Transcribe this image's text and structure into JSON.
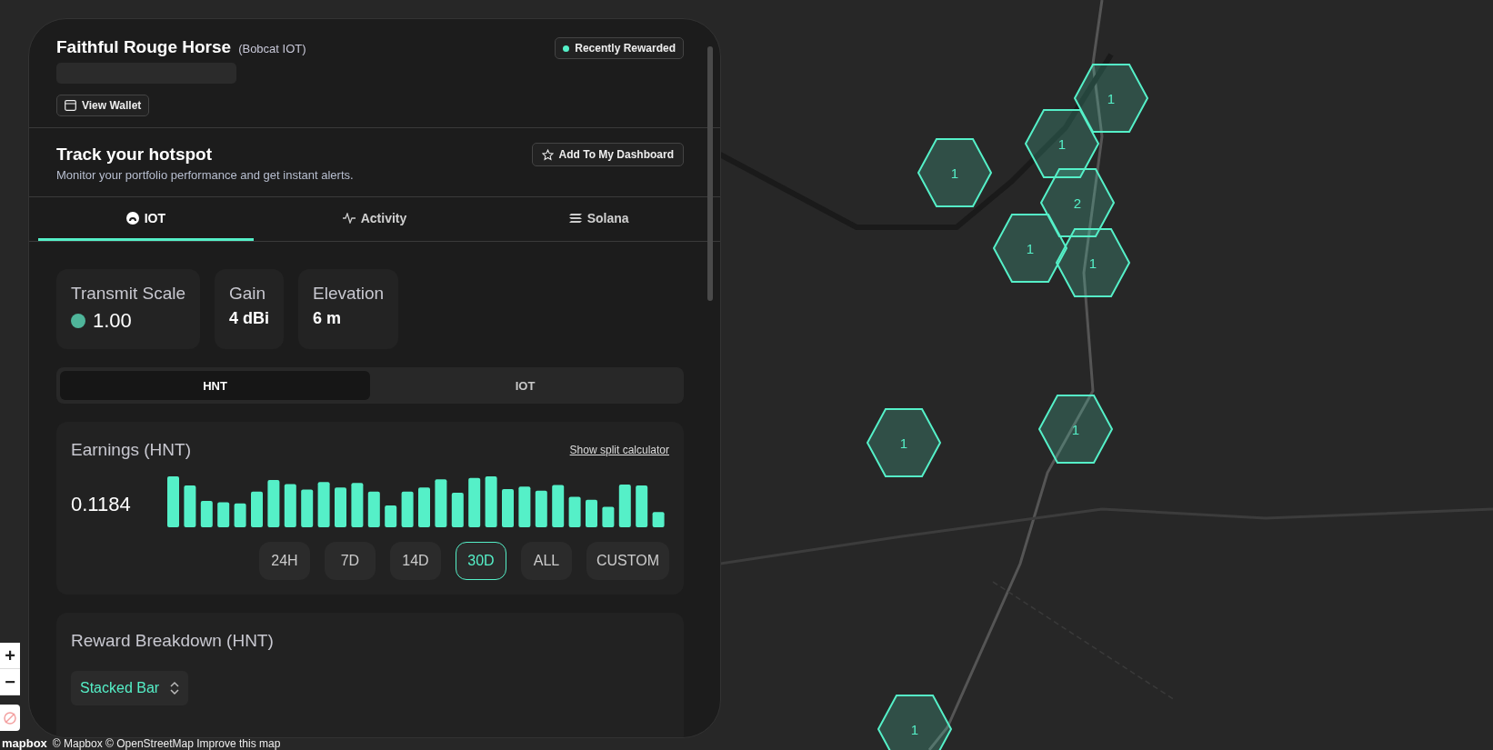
{
  "hotspot": {
    "name": "Faithful Rouge Horse",
    "model": "(Bobcat IOT)",
    "badge": "Recently Rewarded",
    "wallet_button": "View Wallet"
  },
  "track": {
    "title": "Track your hotspot",
    "subtitle": "Monitor your portfolio performance and get instant alerts.",
    "button": "Add To My Dashboard"
  },
  "tabs": [
    {
      "label": "IOT",
      "selected": true
    },
    {
      "label": "Activity",
      "selected": false
    },
    {
      "label": "Solana",
      "selected": false
    }
  ],
  "stats": [
    {
      "label": "Transmit Scale",
      "value": "1.00",
      "kind": "scale"
    },
    {
      "label": "Gain",
      "value": "4 dBi",
      "kind": "plain"
    },
    {
      "label": "Elevation",
      "value": "6 m",
      "kind": "plain"
    }
  ],
  "token_toggle": [
    {
      "label": "HNT",
      "selected": true
    },
    {
      "label": "IOT",
      "selected": false
    }
  ],
  "earnings": {
    "title": "Earnings (HNT)",
    "link": "Show split calculator",
    "total": "0.1184",
    "ranges": [
      {
        "label": "24H",
        "selected": false
      },
      {
        "label": "7D",
        "selected": false
      },
      {
        "label": "14D",
        "selected": false
      },
      {
        "label": "30D",
        "selected": true
      },
      {
        "label": "ALL",
        "selected": false
      },
      {
        "label": "CUSTOM",
        "selected": false
      }
    ]
  },
  "reward_breakdown": {
    "title": "Reward Breakdown (HNT)",
    "chart_type": "Stacked Bar"
  },
  "map": {
    "hexes": [
      {
        "count": "1"
      },
      {
        "count": "1"
      },
      {
        "count": "1"
      },
      {
        "count": "2"
      },
      {
        "count": "1"
      },
      {
        "count": "1"
      },
      {
        "count": "1"
      },
      {
        "count": "1"
      },
      {
        "count": "1"
      }
    ],
    "zoom_in": "+",
    "zoom_out": "−",
    "logo": "mapbox",
    "attribution": "© Mapbox © OpenStreetMap Improve this map"
  }
}
